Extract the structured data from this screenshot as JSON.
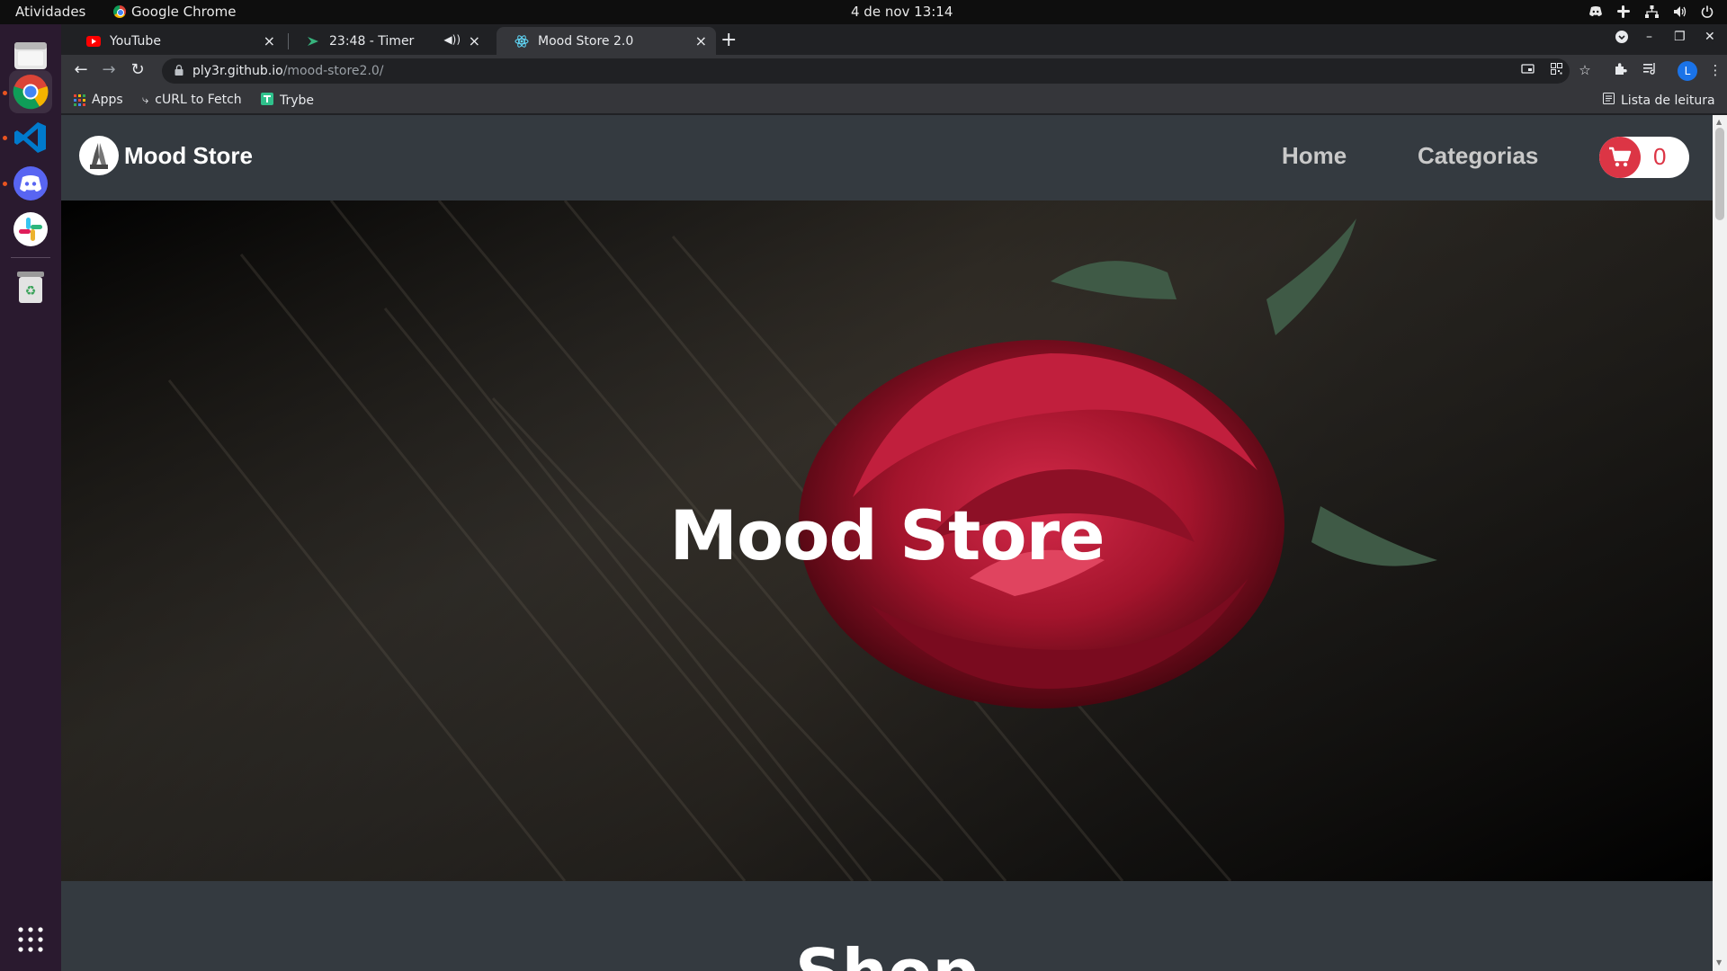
{
  "system": {
    "activities": "Atividades",
    "app_name": "Google Chrome",
    "clock": "4 de nov  13:14"
  },
  "dock": {
    "apps": [
      "files-icon",
      "chrome-icon",
      "vscode-icon",
      "discord-icon",
      "slack-icon",
      "trash-icon",
      "show-apps-icon"
    ]
  },
  "browser": {
    "tabs": [
      {
        "title": "YouTube",
        "icon": "youtube-icon"
      },
      {
        "title": "23:48 - Timer",
        "icon": "timer-icon"
      },
      {
        "title": "Mood Store 2.0",
        "icon": "react-icon",
        "active": true
      }
    ],
    "url_host": "ply3r.github.io",
    "url_path": "/mood-store2.0/",
    "bookmarks": [
      {
        "label": "Apps",
        "icon": "apps-grid-icon"
      },
      {
        "label": "cURL to Fetch",
        "icon": "curl-icon"
      },
      {
        "label": "Trybe",
        "icon": "trybe-icon"
      }
    ],
    "reading_list": "Lista de leitura",
    "profile_initial": "L"
  },
  "page": {
    "brand": "Mood Store",
    "nav": {
      "home": "Home",
      "categories": "Categorias"
    },
    "cart_count": "0",
    "hero_title": "Mood Store",
    "section_title": "Shop"
  },
  "colors": {
    "accent_red": "#dc3545",
    "navbar_bg": "#343a40"
  }
}
